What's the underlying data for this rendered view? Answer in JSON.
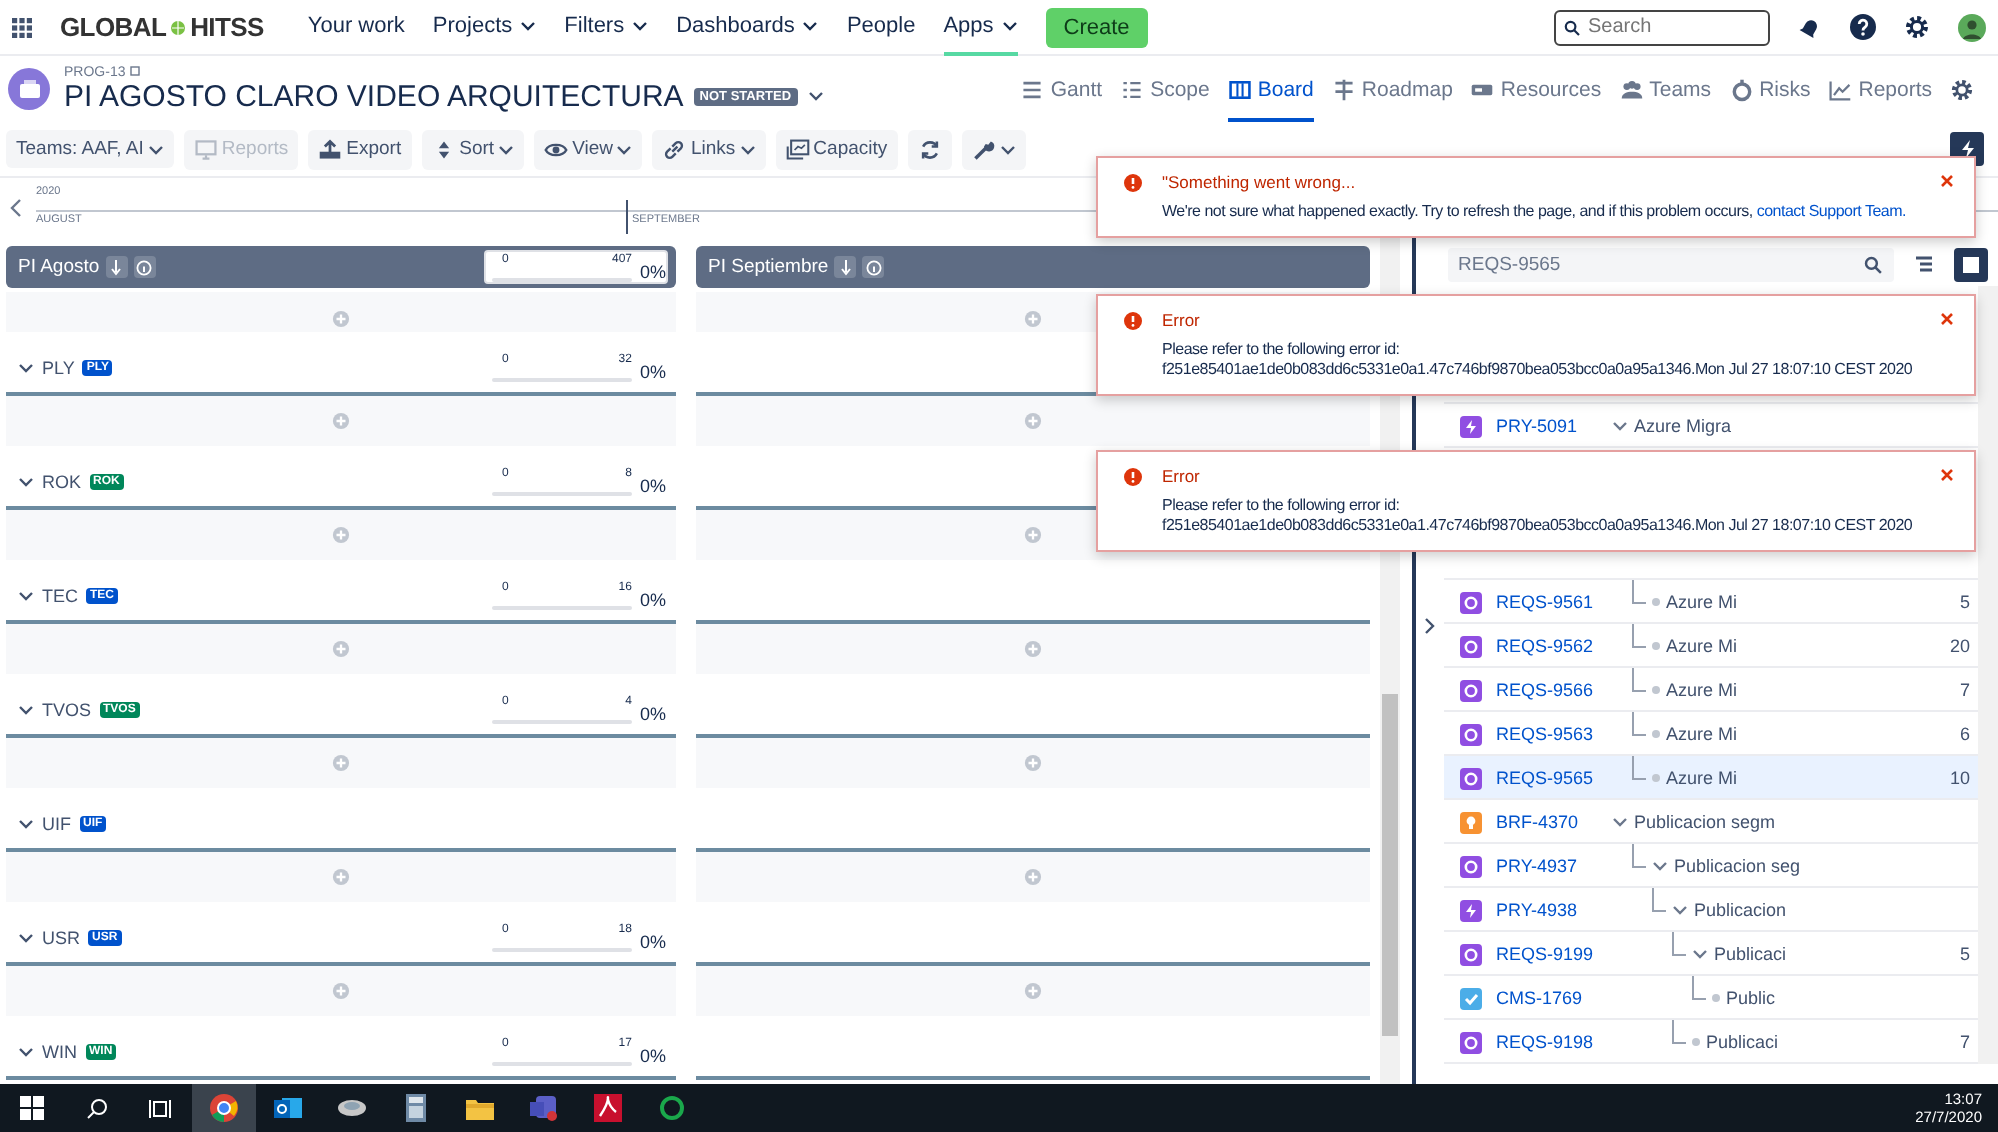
{
  "nav": {
    "logo_left": "GLOBAL",
    "logo_right": "HITSS",
    "items": [
      {
        "label": "Your work",
        "dropdown": false,
        "selected": false
      },
      {
        "label": "Projects",
        "dropdown": true,
        "selected": false
      },
      {
        "label": "Filters",
        "dropdown": true,
        "selected": false
      },
      {
        "label": "Dashboards",
        "dropdown": true,
        "selected": false
      },
      {
        "label": "People",
        "dropdown": false,
        "selected": false
      },
      {
        "label": "Apps",
        "dropdown": true,
        "selected": true
      }
    ],
    "create": "Create",
    "search": {
      "placeholder": "Search"
    }
  },
  "project": {
    "key": "PROG-13",
    "title": "PI AGOSTO CLARO VIDEO ARQUITECTURA",
    "status": "NOT STARTED"
  },
  "view_tabs": [
    {
      "label": "Gantt",
      "kind": "gantt",
      "selected": false
    },
    {
      "label": "Scope",
      "kind": "scope",
      "selected": false
    },
    {
      "label": "Board",
      "kind": "board",
      "selected": true
    },
    {
      "label": "Roadmap",
      "kind": "roadmap",
      "selected": false
    },
    {
      "label": "Resources",
      "kind": "resources",
      "selected": false
    },
    {
      "label": "Teams",
      "kind": "teams",
      "selected": false
    },
    {
      "label": "Risks",
      "kind": "risks",
      "selected": false
    },
    {
      "label": "Reports",
      "kind": "reports",
      "selected": false
    }
  ],
  "toolbar": {
    "teams": "Teams: AAF, AI",
    "buttons": [
      {
        "label": "Reports",
        "kind": "reports",
        "disabled": true,
        "dropdown": false
      },
      {
        "label": "Export",
        "kind": "export",
        "disabled": false,
        "dropdown": false
      },
      {
        "label": "Sort",
        "kind": "sort",
        "disabled": false,
        "dropdown": true
      },
      {
        "label": "View",
        "kind": "view",
        "disabled": false,
        "dropdown": true
      },
      {
        "label": "Links",
        "kind": "links",
        "disabled": false,
        "dropdown": true
      },
      {
        "label": "Capacity",
        "kind": "capacity",
        "disabled": false,
        "dropdown": false
      },
      {
        "kind": "refresh",
        "disabled": false,
        "dropdown": false
      },
      {
        "kind": "tools",
        "disabled": false,
        "dropdown": true
      }
    ]
  },
  "timeline": {
    "year": "2020",
    "months": [
      "AUGUST",
      "SEPTEMBER"
    ]
  },
  "sprints": [
    {
      "name": "PI Agosto",
      "capacity": {
        "used": "0",
        "total": "407",
        "percent": "0%",
        "level": 0
      }
    },
    {
      "name": "PI Septiembre"
    }
  ],
  "teams": [
    {
      "name": "PLY",
      "badge": "PLY",
      "color": "#0052cc",
      "capacity": {
        "used": "0",
        "total": "32",
        "percent": "0%",
        "level": 0
      }
    },
    {
      "name": "ROK",
      "badge": "ROK",
      "color": "#00875a",
      "capacity": {
        "used": "0",
        "total": "8",
        "percent": "0%",
        "level": 0
      }
    },
    {
      "name": "TEC",
      "badge": "TEC",
      "color": "#0052cc",
      "capacity": {
        "used": "0",
        "total": "16",
        "percent": "0%",
        "level": 0
      }
    },
    {
      "name": "TVOS",
      "badge": "TVOS",
      "color": "#00875a",
      "capacity": {
        "used": "0",
        "total": "4",
        "percent": "0%",
        "level": 0
      }
    },
    {
      "name": "UIF",
      "badge": "UIF",
      "color": "#0052cc"
    },
    {
      "name": "USR",
      "badge": "USR",
      "color": "#0052cc",
      "capacity": {
        "used": "0",
        "total": "18",
        "percent": "0%",
        "level": 0
      }
    },
    {
      "name": "WIN",
      "badge": "WIN",
      "color": "#00875a",
      "capacity": {
        "used": "0",
        "total": "17",
        "percent": "0%",
        "level": 0
      }
    }
  ],
  "tree_search": {
    "value": "REQS-9565"
  },
  "tree": [
    {
      "key": "PRY-5091",
      "kind": "epic",
      "title": "Azure Migra",
      "expanded": true,
      "selected": false,
      "children": [
        {
          "key": "REQS-9561",
          "kind": "story",
          "title": "Azure Mi",
          "estimate": "5",
          "selected": false
        },
        {
          "key": "REQS-9562",
          "kind": "story",
          "title": "Azure Mi",
          "estimate": "20",
          "selected": false
        },
        {
          "key": "REQS-9566",
          "kind": "story",
          "title": "Azure Mi",
          "estimate": "7",
          "selected": false
        },
        {
          "key": "REQS-9563",
          "kind": "story",
          "title": "Azure Mi",
          "estimate": "6",
          "selected": false
        },
        {
          "key": "REQS-9565",
          "kind": "story",
          "title": "Azure Mi",
          "estimate": "10",
          "selected": true
        }
      ]
    },
    {
      "key": "BRF-4370",
      "kind": "idea",
      "title": "Publicacion segm",
      "expanded": true,
      "selected": false,
      "children": [
        {
          "key": "PRY-4937",
          "kind": "story",
          "title": "Publicacion seg",
          "expanded": true,
          "selected": false,
          "children": [
            {
              "key": "PRY-4938",
              "kind": "epic",
              "title": "Publicacion",
              "expanded": true,
              "selected": false,
              "children": [
                {
                  "key": "REQS-9199",
                  "kind": "story",
                  "title": "Publicaci",
                  "estimate": "5",
                  "expanded": true,
                  "selected": false,
                  "children": [
                    {
                      "key": "CMS-1769",
                      "kind": "task",
                      "title": "Public",
                      "selected": false
                    }
                  ]
                },
                {
                  "key": "REQS-9198",
                  "kind": "story",
                  "title": "Publicaci",
                  "estimate": "7",
                  "selected": false
                }
              ]
            }
          ]
        }
      ]
    }
  ],
  "toasts": [
    {
      "title": "\"Something went wrong...",
      "lines": [
        "We're not sure what happened exactly. Try to refresh the page, and if this problem occurs,"
      ],
      "link": "contact Support Team."
    },
    {
      "title": "Error",
      "lines": [
        "Please refer to the following error id:",
        "f251e85401ae1de0b083dd6c5331e0a1.47c746bf9870bea053bcc0a0a95a1346.Mon Jul 27 18:07:10 CEST 2020"
      ]
    },
    {
      "title": "Error",
      "lines": [
        "Please refer to the following error id:",
        "f251e85401ae1de0b083dd6c5331e0a1.47c746bf9870bea053bcc0a0a95a1346.Mon Jul 27 18:07:10 CEST 2020"
      ]
    }
  ],
  "taskbar": {
    "apps": [
      {
        "kind": "browser",
        "active": true
      },
      {
        "kind": "mail",
        "active": false
      },
      {
        "kind": "remote",
        "active": false
      },
      {
        "kind": "calculator",
        "active": false
      },
      {
        "kind": "folder",
        "active": false
      },
      {
        "kind": "chat",
        "active": false
      },
      {
        "kind": "pdf",
        "active": false
      },
      {
        "kind": "ring",
        "active": false
      }
    ],
    "time": "13:07",
    "date": "27/7/2020"
  }
}
